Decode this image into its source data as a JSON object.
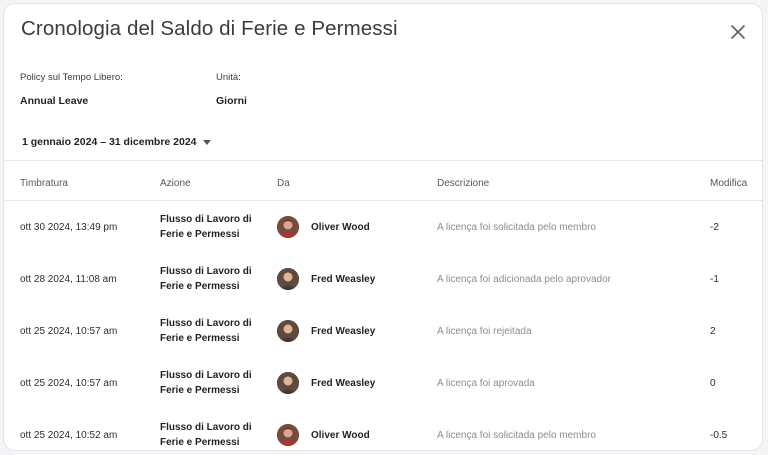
{
  "dialog": {
    "title": "Cronologia del Saldo di Ferie e Permessi",
    "close_icon": "close-icon"
  },
  "meta": {
    "policy_label": "Policy sul Tempo Libero:",
    "policy_value": "Annual Leave",
    "unit_label": "Unità:",
    "unit_value": "Giorni"
  },
  "filter": {
    "date_range": "1 gennaio 2024 – 31 dicembre 2024",
    "caret_icon": "caret-down-icon"
  },
  "table": {
    "headers": [
      "Timbratura",
      "Azione",
      "Da",
      "Descrizione",
      "Modifica"
    ],
    "rows": [
      {
        "timestamp": "ott 30 2024, 13:49 pm",
        "action_line1": "Flusso di Lavoro di",
        "action_line2": "Ferie e Permessi",
        "from": "Oliver Wood",
        "description": "A licença foi solicitada pelo membro",
        "change": "-2"
      },
      {
        "timestamp": "ott 28 2024, 11:08 am",
        "action_line1": "Flusso di Lavoro di",
        "action_line2": "Ferie e Permessi",
        "from": "Fred Weasley",
        "description": "A licença foi adicionada pelo aprovador",
        "change": "-1"
      },
      {
        "timestamp": "ott 25 2024, 10:57 am",
        "action_line1": "Flusso di Lavoro di",
        "action_line2": "Ferie e Permessi",
        "from": "Fred Weasley",
        "description": "A licença foi rejeitada",
        "change": "2"
      },
      {
        "timestamp": "ott 25 2024, 10:57 am",
        "action_line1": "Flusso di Lavoro di",
        "action_line2": "Ferie e Permessi",
        "from": "Fred Weasley",
        "description": "A licença foi aprovada",
        "change": "0"
      },
      {
        "timestamp": "ott 25 2024, 10:52 am",
        "action_line1": "Flusso di Lavoro di",
        "action_line2": "Ferie e Permessi",
        "from": "Oliver Wood",
        "description": "A licença foi solicitada pelo membro",
        "change": "-0.5"
      }
    ]
  }
}
